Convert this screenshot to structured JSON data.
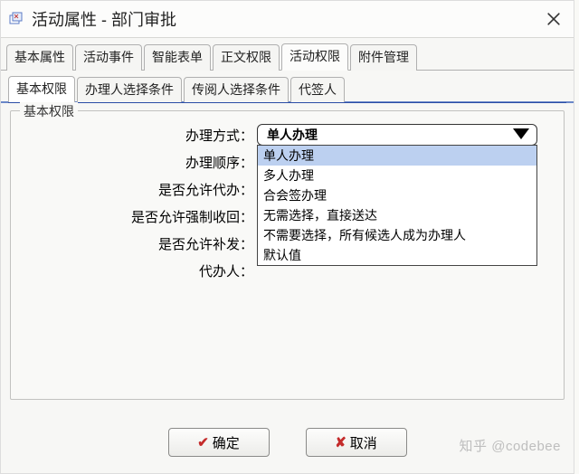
{
  "window": {
    "title": "活动属性 - 部门审批"
  },
  "tabs": {
    "items": [
      {
        "label": "基本属性"
      },
      {
        "label": "活动事件"
      },
      {
        "label": "智能表单"
      },
      {
        "label": "正文权限"
      },
      {
        "label": "活动权限",
        "active": true
      },
      {
        "label": "附件管理"
      }
    ]
  },
  "subtabs": {
    "items": [
      {
        "label": "基本权限",
        "active": true
      },
      {
        "label": "办理人选择条件"
      },
      {
        "label": "传阅人选择条件"
      },
      {
        "label": "代签人"
      }
    ]
  },
  "group": {
    "title": "基本权限",
    "labels": {
      "method": "办理方式：",
      "order": "办理顺序：",
      "allow_proxy": "是否允许代办：",
      "allow_recall": "是否允许强制收回：",
      "allow_reissue": "是否允许补发：",
      "proxy_person": "代办人："
    },
    "method_value": "单人办理",
    "options": [
      "单人办理",
      "多人办理",
      "合会签办理",
      "无需选择，直接送达",
      "不需要选择，所有候选人成为办理人",
      "默认值"
    ],
    "selected_index": 0
  },
  "buttons": {
    "ok": "确定",
    "cancel": "取消"
  },
  "watermark": "知乎 @codebee"
}
